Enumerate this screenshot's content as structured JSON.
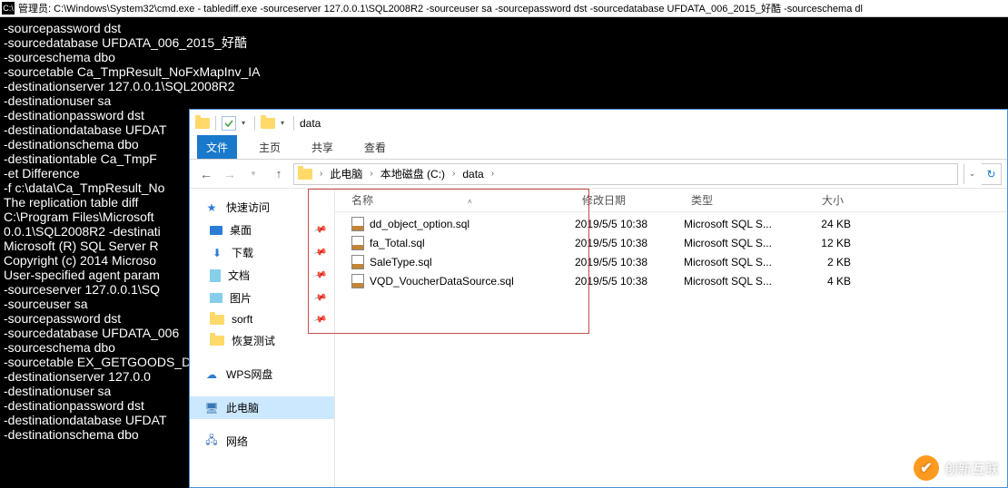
{
  "cmd": {
    "title": "管理员: C:\\Windows\\System32\\cmd.exe - tablediff.exe   -sourceserver 127.0.0.1\\SQL2008R2 -sourceuser sa -sourcepassword dst -sourcedatabase UFDATA_006_2015_好酷 -sourceschema dl",
    "lines": [
      "-sourcepassword dst",
      "-sourcedatabase UFDATA_006_2015_好酷",
      "-sourceschema dbo",
      "-sourcetable Ca_TmpResult_NoFxMapInv_IA",
      "-destinationserver 127.0.0.1\\SQL2008R2",
      "-destinationuser sa",
      "-destinationpassword dst",
      "-destinationdatabase UFDAT",
      "-destinationschema dbo",
      "-destinationtable Ca_TmpF",
      "-et Difference",
      "-f c:\\data\\Ca_TmpResult_No",
      "",
      "The replication table diff",
      "",
      "C:\\Program Files\\Microsoft",
      "0.0.1\\SQL2008R2 -destinati",
      "Microsoft (R) SQL Server R",
      "Copyright (c) 2014 Microso",
      "",
      "User-specified agent param",
      "-sourceserver 127.0.0.1\\SQ",
      "-sourceuser sa",
      "-sourcepassword dst",
      "-sourcedatabase UFDATA_006",
      "-sourceschema dbo",
      "-sourcetable EX_GETGOODS_D",
      "-destinationserver 127.0.0",
      "-destinationuser sa",
      "-destinationpassword dst",
      "-destinationdatabase UFDAT",
      "-destinationschema dbo"
    ]
  },
  "explorer": {
    "title": "data",
    "tabs": {
      "file": "文件",
      "home": "主页",
      "share": "共享",
      "view": "查看"
    },
    "breadcrumbs": [
      "此电脑",
      "本地磁盘 (C:)",
      "data"
    ],
    "sidebar": {
      "quick_access": "快速访问",
      "desktop": "桌面",
      "downloads": "下载",
      "documents": "文档",
      "pictures": "图片",
      "sorft": "sorft",
      "recovery_test": "恢复测试",
      "wps": "WPS网盘",
      "this_pc": "此电脑",
      "network": "网络"
    },
    "columns": {
      "name": "名称",
      "date": "修改日期",
      "type": "类型",
      "size": "大小"
    },
    "files": [
      {
        "name": "dd_object_option.sql",
        "date": "2019/5/5 10:38",
        "type": "Microsoft SQL S...",
        "size": "24 KB"
      },
      {
        "name": "fa_Total.sql",
        "date": "2019/5/5 10:38",
        "type": "Microsoft SQL S...",
        "size": "12 KB"
      },
      {
        "name": "SaleType.sql",
        "date": "2019/5/5 10:38",
        "type": "Microsoft SQL S...",
        "size": "2 KB"
      },
      {
        "name": "VQD_VoucherDataSource.sql",
        "date": "2019/5/5 10:38",
        "type": "Microsoft SQL S...",
        "size": "4 KB"
      }
    ]
  },
  "watermark": "创新互联"
}
